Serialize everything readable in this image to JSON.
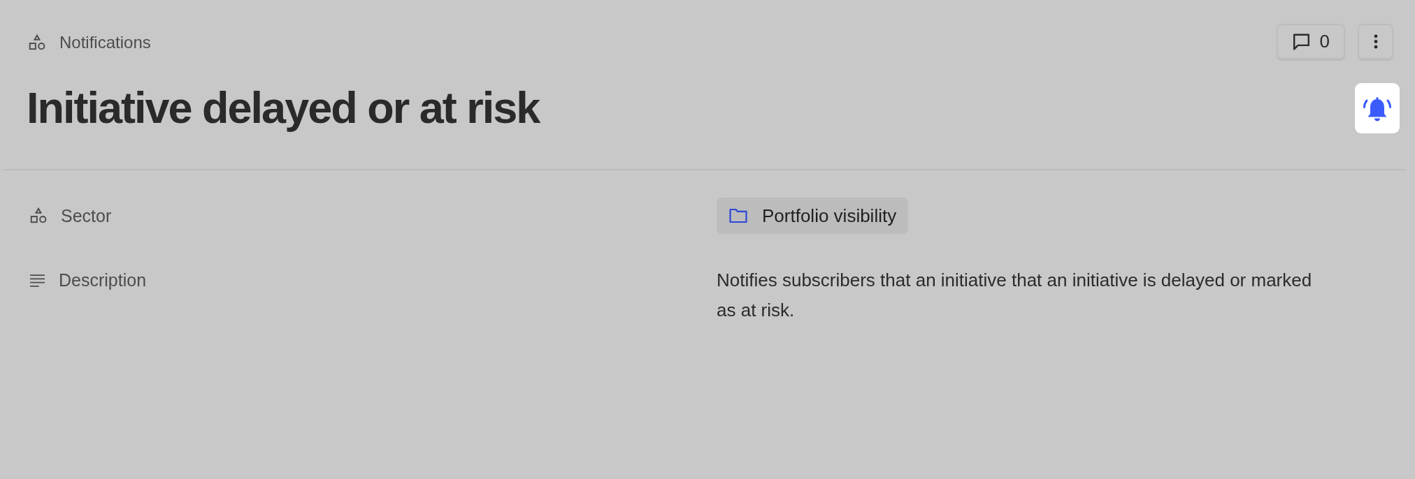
{
  "breadcrumb": {
    "label": "Notifications"
  },
  "toolbar": {
    "comments": {
      "count": "0"
    }
  },
  "title": "Initiative delayed or at risk",
  "properties": [
    {
      "kind": "chip",
      "label": "Sector",
      "value": "Portfolio visibility"
    },
    {
      "kind": "text",
      "label": "Description",
      "value": "Notifies subscribers that an initiative that an initiative is delayed or marked as at risk."
    }
  ]
}
